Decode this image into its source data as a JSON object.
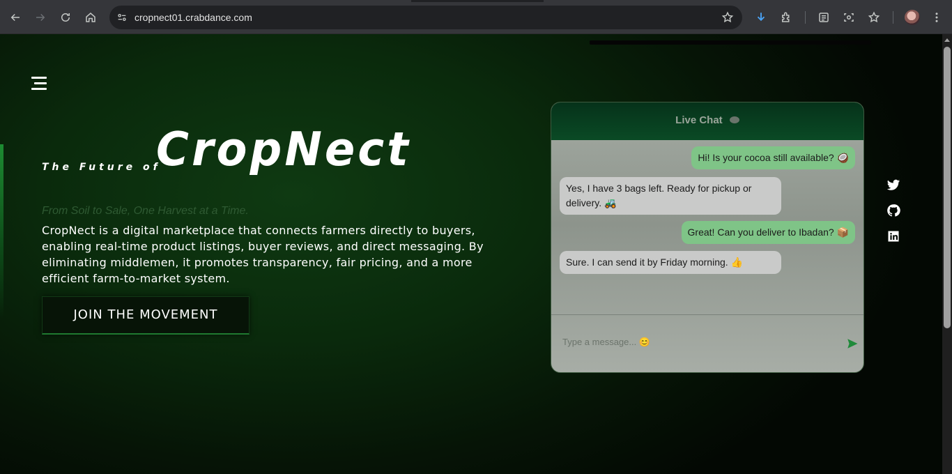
{
  "browser": {
    "url": "cropnect01.crabdance.com",
    "icons": [
      "back-icon",
      "forward-icon",
      "reload-icon",
      "home-icon",
      "site-info-icon",
      "bookmark-star-icon",
      "download-icon",
      "extensions-icon",
      "reading-list-icon",
      "screenshot-icon",
      "favorites-icon",
      "profile-avatar",
      "menu-icon"
    ]
  },
  "hero": {
    "pre_title": "The Future of",
    "title": "CropNect",
    "tagline": "From Soil to Sale, One Harvest at a Time.",
    "description": "CropNect is a digital marketplace that connects farmers directly to buyers, enabling real-time product listings, buyer reviews, and direct messaging. By eliminating middlemen, it promotes transparency, fair pricing, and a more efficient farm-to-market system.",
    "cta_label": "JOIN THE MOVEMENT"
  },
  "chat": {
    "title": "Live Chat",
    "messages": [
      {
        "from": "sent",
        "text": "Hi! Is your cocoa still available? 🥥"
      },
      {
        "from": "recv",
        "text": "Yes, I have 3 bags left. Ready for pickup or delivery. 🚜"
      },
      {
        "from": "sent",
        "text": "Great! Can you deliver to Ibadan? 📦"
      },
      {
        "from": "recv",
        "text": "Sure. I can send it by Friday morning. 👍"
      }
    ],
    "input_placeholder": "Type a message... 😊"
  },
  "social": [
    "twitter-icon",
    "github-icon",
    "linkedin-icon"
  ],
  "colors": {
    "page_bg": "#0a2a0c",
    "accent_green": "#1f7a30",
    "sent_bubble": "#7fc487",
    "recv_bubble": "#c9cac9",
    "chat_header": "#06321a"
  }
}
